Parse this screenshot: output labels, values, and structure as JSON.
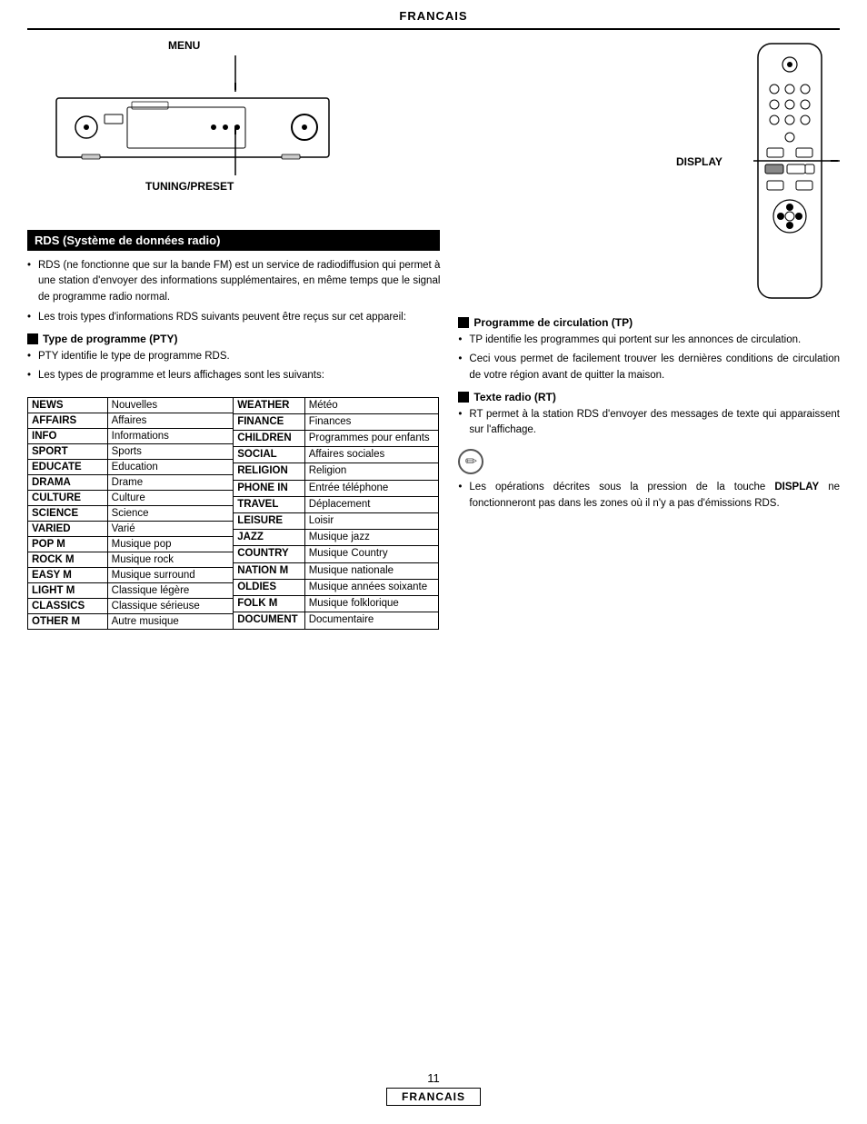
{
  "header": {
    "title": "FRANCAIS"
  },
  "footer": {
    "page_number": "11",
    "label": "FRANCAIS"
  },
  "diagram": {
    "label_menu": "MENU",
    "label_tuning": "TUNING/PRESET",
    "label_display": "DISPLAY"
  },
  "rds": {
    "title": "RDS (Système de données radio)",
    "text1": "RDS (ne fonctionne que sur la bande FM) est un service de radiodiffusion qui permet à une station d'envoyer des informations supplémentaires, en même temps que le signal de programme radio normal.",
    "text2": "Les trois types d'informations RDS suivants peuvent être reçus sur cet appareil:",
    "pty": {
      "header": "Type de programme (PTY)",
      "bullet1": "PTY identifie le type de programme RDS.",
      "bullet2": "Les types de programme et leurs affichages sont les suivants:"
    },
    "tp": {
      "header": "Programme de circulation (TP)",
      "bullet1": "TP identifie les programmes qui portent sur les annonces de circulation.",
      "bullet2": "Ceci vous permet de facilement trouver les dernières conditions de circulation de votre région avant de quitter la maison."
    },
    "rt": {
      "header": "Texte radio (RT)",
      "bullet1": "RT permet à la station RDS d'envoyer des messages de texte qui apparaissent sur l'affichage."
    },
    "note": {
      "bullet1": "Les opérations décrites sous la pression de la touche DISPLAY ne fonctionneront pas dans les zones où il n'y a pas d'émissions RDS.",
      "display_bold": "DISPLAY"
    }
  },
  "table": {
    "rows_left": [
      {
        "code": "NEWS",
        "description": "Nouvelles"
      },
      {
        "code": "AFFAIRS",
        "description": "Affaires"
      },
      {
        "code": "INFO",
        "description": "Informations"
      },
      {
        "code": "SPORT",
        "description": "Sports"
      },
      {
        "code": "EDUCATE",
        "description": "Education"
      },
      {
        "code": "DRAMA",
        "description": "Drame"
      },
      {
        "code": "CULTURE",
        "description": "Culture"
      },
      {
        "code": "SCIENCE",
        "description": "Science"
      },
      {
        "code": "VARIED",
        "description": "Varié"
      },
      {
        "code": "POP M",
        "description": "Musique pop"
      },
      {
        "code": "ROCK M",
        "description": "Musique rock"
      },
      {
        "code": "EASY M",
        "description": "Musique surround"
      },
      {
        "code": "LIGHT M",
        "description": "Classique légère"
      },
      {
        "code": "CLASSICS",
        "description": "Classique sérieuse"
      },
      {
        "code": "OTHER M",
        "description": "Autre musique"
      }
    ],
    "rows_right": [
      {
        "code": "WEATHER",
        "description": "Météo"
      },
      {
        "code": "FINANCE",
        "description": "Finances"
      },
      {
        "code": "CHILDREN",
        "description": "Programmes pour enfants"
      },
      {
        "code": "SOCIAL",
        "description": "Affaires sociales"
      },
      {
        "code": "RELIGION",
        "description": "Religion"
      },
      {
        "code": "PHONE IN",
        "description": "Entrée téléphone"
      },
      {
        "code": "TRAVEL",
        "description": "Déplacement"
      },
      {
        "code": "LEISURE",
        "description": "Loisir"
      },
      {
        "code": "JAZZ",
        "description": "Musique jazz"
      },
      {
        "code": "COUNTRY",
        "description": "Musique Country"
      },
      {
        "code": "NATION M",
        "description": "Musique nationale"
      },
      {
        "code": "OLDIES",
        "description": "Musique années soixante"
      },
      {
        "code": "FOLK M",
        "description": "Musique folklorique"
      },
      {
        "code": "DOCUMENT",
        "description": "Documentaire"
      }
    ]
  }
}
